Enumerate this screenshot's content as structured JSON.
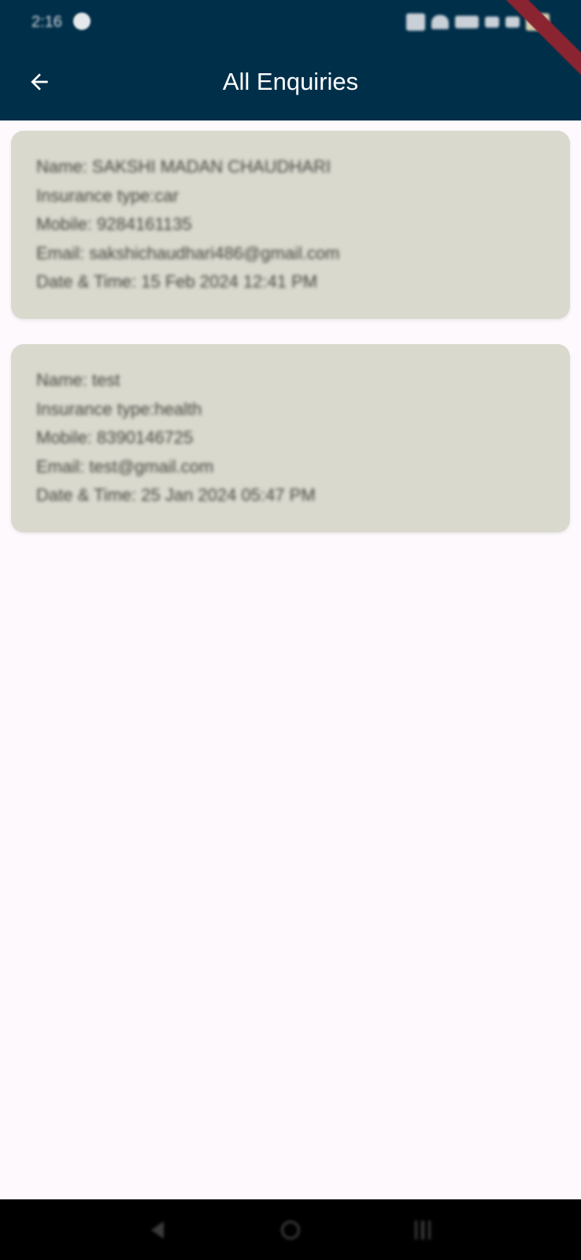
{
  "status_bar": {
    "time": "2:16"
  },
  "app_bar": {
    "back_icon": "arrow-left-icon",
    "title": "All Enquiries"
  },
  "enquiries": [
    {
      "name": "Name: SAKSHI MADAN CHAUDHARI",
      "insurance_type": "Insurance type:car",
      "mobile": "Mobile: 9284161135",
      "email": "Email: sakshichaudhari486@gmail.com",
      "datetime": "Date & Time: 15 Feb 2024 12:41 PM"
    },
    {
      "name": "Name: test",
      "insurance_type": "Insurance type:health",
      "mobile": "Mobile: 8390146725",
      "email": "Email: test@gmail.com",
      "datetime": "Date & Time: 25 Jan 2024 05:47 PM"
    }
  ],
  "colors": {
    "app_bar": "#002f4a",
    "card": "#dad9ce",
    "background": "#fdf9fd",
    "text": "#45443f"
  }
}
